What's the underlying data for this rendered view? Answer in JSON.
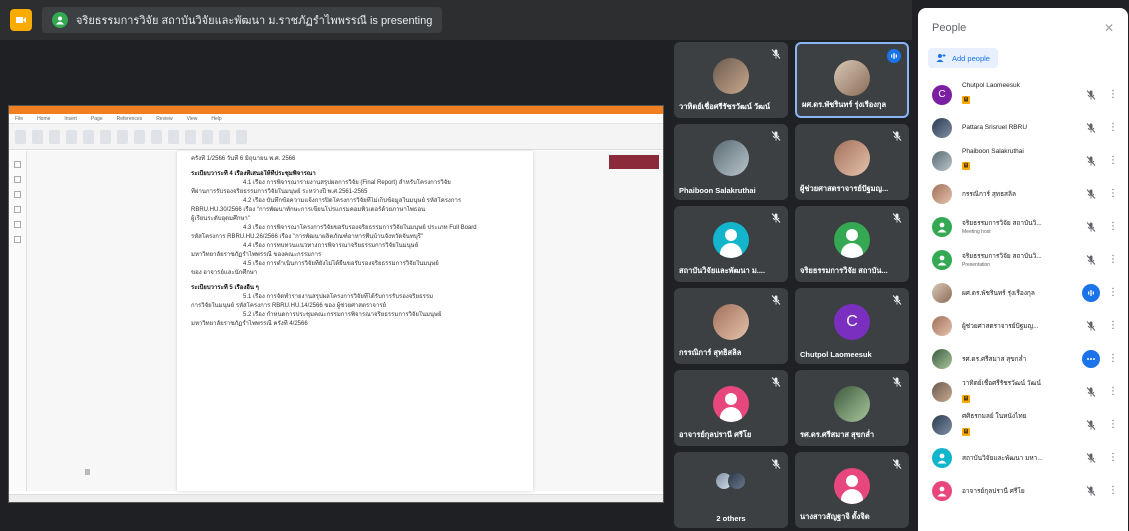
{
  "topbar": {
    "presenting_text": "จริยธรรมการวิจัย สถาบันวิจัยและพัฒนา ม.ราชภัฏรำไพพรรณี is presenting"
  },
  "document": {
    "menu": [
      "File",
      "Home",
      "Insert",
      "Page",
      "References",
      "Review",
      "View",
      "Help"
    ],
    "lines": [
      {
        "text": "ครั้งที่ 1/2566 วันที่ 6 มิถุนายน พ.ศ. 2566",
        "kind": "normal"
      },
      {
        "text": "ระเบียบวาระที่ 4  เรื่องที่เสนอให้ที่ประชุมพิจารณา",
        "kind": "head"
      },
      {
        "text": "4.1 เรื่อง การพิจารณารายงานสรุปผลการวิจัย (Final Report) สำหรับโครงการวิจัย",
        "kind": "ind"
      },
      {
        "text": "ที่ผ่านการรับรองจริยธรรมการวิจัยในมนุษย์ ระหว่างปี พ.ศ.2561-2565",
        "kind": "normal"
      },
      {
        "text": "4.2 เรื่อง บันทึกข้อความแจ้งการปิดโครงการวิจัยที่ไม่เก็บข้อมูลในมนุษย์ รหัสโครงการ",
        "kind": "ind"
      },
      {
        "text": "RBRU.HU.30/2566 เรื่อง \"การพัฒนาทักษะการเขียนโปรแกรมคอมพิวเตอร์ด้วยภาษาไพธอน",
        "kind": "normal"
      },
      {
        "text": "ผู้เรียนระดับอุดมศึกษา\"",
        "kind": "normal"
      },
      {
        "text": "4.3 เรื่อง การพิจารณาโครงการวิจัยขอรับรองจริยธรรมการวิจัยในมนุษย์ ประเภท Full Board",
        "kind": "ind"
      },
      {
        "text": "รหัสโครงการ RBRU.HU.26/2566 เรื่อง \"การพัฒนาผลิตภัณฑ์อาหารพื้นบ้านจังหวัดจันทบุรี\"",
        "kind": "normal"
      },
      {
        "text": "4.4 เรื่อง การทบทวนแนวทางการพิจารณาจริยธรรมการวิจัยในมนุษย์",
        "kind": "ind"
      },
      {
        "text": "มหาวิทยาลัยราชภัฏรำไพพรรณี ของคณะกรรมการ",
        "kind": "normal"
      },
      {
        "text": "4.5 เรื่อง การดำเนินการวิจัยที่ยังไม่ได้ยื่นขอรับรองจริยธรรมการวิจัยในมนุษย์",
        "kind": "ind"
      },
      {
        "text": "ของ อาจารย์และนักศึกษา",
        "kind": "normal"
      },
      {
        "text": "ระเบียบวาระที่ 5  เรื่องอื่น ๆ",
        "kind": "head"
      },
      {
        "text": "5.1 เรื่อง การจัดทำรายงานสรุปผลโครงการวิจัยที่ได้รับการรับรองจริยธรรม",
        "kind": "ind"
      },
      {
        "text": "การวิจัยในมนุษย์ รหัสโครงการ RBRU.HU.14/2566 ของ ผู้ช่วยศาสตราจารย์",
        "kind": "normal"
      },
      {
        "text": "5.2 เรื่อง กำหนดการประชุมคณะกรรมการพิจารณาจริยธรรมการวิจัยในมนุษย์",
        "kind": "ind"
      },
      {
        "text": "มหาวิทยาลัยราชภัฏรำไพพรรณี ครั้งที่ 4/2566",
        "kind": "normal"
      }
    ]
  },
  "tiles": [
    {
      "name": "วาทิตย์เชื่อศรีรัชรวัฒน์ วัฒน์",
      "avatar": "photo",
      "speaking": false
    },
    {
      "name": "ผศ.ดร.พัชรินทร์ รุ่งเรืองกุล",
      "avatar": "photo2",
      "speaking": true
    },
    {
      "name": "Phaiboon Salakruthai",
      "avatar": "photo3",
      "speaking": false
    },
    {
      "name": "ผู้ช่วยศาสตราจารย์ปัฐมญ...",
      "avatar": "photo5",
      "speaking": false
    },
    {
      "name": "สถาบันวิจัยและพัฒนา ม....",
      "avatar": "teal",
      "speaking": false
    },
    {
      "name": "จริยธรรมการวิจัย สถาบัน...",
      "avatar": "green",
      "speaking": false
    },
    {
      "name": "กรรณิการ์ สุทธิสลิล",
      "avatar": "photo5",
      "speaking": false
    },
    {
      "name": "Chutpol Laomeesuk",
      "avatar": "C",
      "speaking": false
    },
    {
      "name": "อาจารย์กุลปรานี ศรีโย",
      "avatar": "pink",
      "speaking": false
    },
    {
      "name": "รศ.ดร.ศรีสมาส สุขกล่ำ",
      "avatar": "photo4",
      "speaking": false
    },
    {
      "name": "2 others",
      "avatar": "others",
      "speaking": false
    },
    {
      "name": "นางสาวสัญฐาจิ ตั้งจิต",
      "avatar": "pink",
      "speaking": false
    }
  ],
  "panel": {
    "title": "People",
    "add_label": "Add people",
    "people": [
      {
        "name": "Chutpol Laomeesuk",
        "sub": "",
        "hand": true,
        "avatar": "C",
        "color": "#7b1fa2",
        "mic": "off"
      },
      {
        "name": "Pattara Srisruel RBRU",
        "sub": "",
        "hand": false,
        "avatar": "photo6",
        "color": "",
        "mic": "off"
      },
      {
        "name": "Phaiboon Salakruthai",
        "sub": "",
        "hand": true,
        "avatar": "photo3",
        "color": "",
        "mic": "off"
      },
      {
        "name": "กรรณิการ์ สุทธสลิล",
        "sub": "",
        "hand": false,
        "avatar": "photo5",
        "color": "",
        "mic": "off"
      },
      {
        "name": "จริยธรรมการวิจัย สถาบันวิ...",
        "sub": "Meeting host",
        "hand": false,
        "avatar": "person",
        "color": "#34a853",
        "mic": "off"
      },
      {
        "name": "จริยธรรมการวิจัย สถาบันวิ...",
        "sub": "Presentation",
        "hand": false,
        "avatar": "person",
        "color": "#34a853",
        "mic": "off"
      },
      {
        "name": "ผศ.ดร.พัชรินทร์ รุ่งเรืองกุล",
        "sub": "",
        "hand": false,
        "avatar": "photo2",
        "color": "",
        "mic": "speaking"
      },
      {
        "name": "ผู้ช่วยศาสตราจารย์ปัฐมญ...",
        "sub": "",
        "hand": false,
        "avatar": "photo5",
        "color": "",
        "mic": "off"
      },
      {
        "name": "รศ.ดร.ศรีสมาส สุขกล่ำ",
        "sub": "",
        "hand": false,
        "avatar": "photo4",
        "color": "",
        "mic": "dots"
      },
      {
        "name": "วาทิตย์เชื่อศรีรัชรวัฒน์ วัฒน์",
        "sub": "",
        "hand": true,
        "avatar": "photo",
        "color": "",
        "mic": "off"
      },
      {
        "name": "ศศิธรกมลย์ ในหนังไทย",
        "sub": "",
        "hand": true,
        "avatar": "photo6",
        "color": "",
        "mic": "off"
      },
      {
        "name": "สถาบันวิจัยและพัฒนา มหา...",
        "sub": "",
        "hand": false,
        "avatar": "person",
        "color": "#12b5cb",
        "mic": "off"
      },
      {
        "name": "อาจารย์กุลปรานี ศรีโย",
        "sub": "",
        "hand": false,
        "avatar": "person",
        "color": "#e8477e",
        "mic": "off"
      }
    ]
  }
}
